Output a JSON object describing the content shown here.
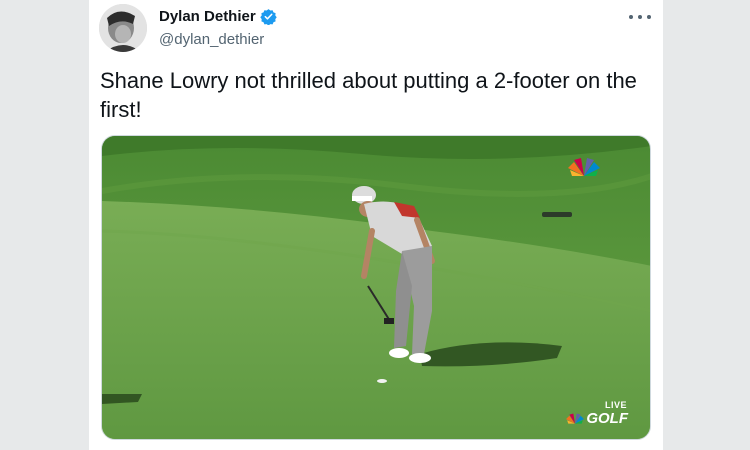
{
  "author": {
    "name": "Dylan Dethier",
    "handle": "@dylan_dethier",
    "verified_icon": "verified-badge-icon"
  },
  "menu_icon": "more-options-icon",
  "tweet": {
    "text": "Shane Lowry not thrilled about putting a 2-footer on the first!"
  },
  "media": {
    "type": "video-frame",
    "broadcast_tag": "LIVE",
    "network_label": "GOLF"
  },
  "colors": {
    "verified_blue": "#1d9bf0",
    "text_primary": "#0f1419",
    "text_secondary": "#536471",
    "grass_light": "#6ea04a",
    "grass_dark": "#4f8534"
  }
}
